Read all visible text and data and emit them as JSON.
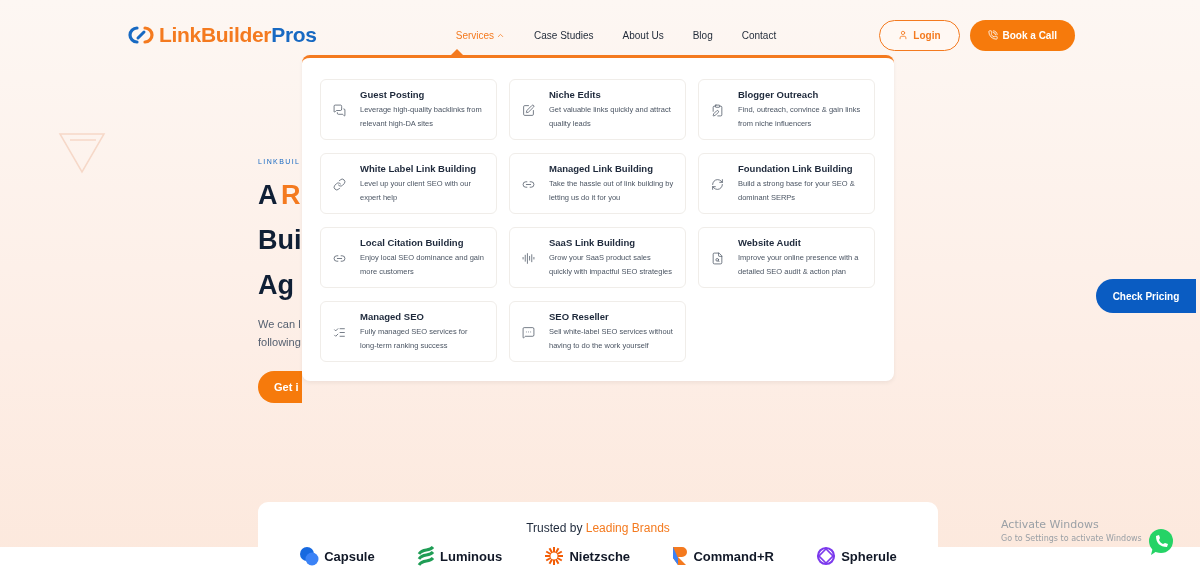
{
  "header": {
    "logo": {
      "part_1": "LinkBuilder",
      "part_2": "Pros"
    },
    "nav": [
      {
        "label": "Services",
        "selected": true,
        "expanded": true
      },
      {
        "label": "Case Studies",
        "selected": false
      },
      {
        "label": "About Us",
        "selected": false
      },
      {
        "label": "Blog",
        "selected": false
      },
      {
        "label": "Contact",
        "selected": false
      }
    ],
    "login": "Login",
    "book_call": "Book a Call"
  },
  "services_menu": [
    {
      "title": "Guest Posting",
      "description": "Leverage high-quality backlinks from relevant high-DA sites"
    },
    {
      "title": "Niche Edits",
      "description": "Get valuable links quickly and attract quality leads"
    },
    {
      "title": "Blogger Outreach",
      "description": "Find, outreach, convince & gain links from niche influencers"
    },
    {
      "title": "White Label Link Building",
      "description": "Level up your client SEO with our expert help"
    },
    {
      "title": "Managed Link Building",
      "description": "Take the hassle out of link building by letting us do it for you"
    },
    {
      "title": "Foundation Link Building",
      "description": "Build a strong base for your SEO & dominant SERPs"
    },
    {
      "title": "Local Citation Building",
      "description": "Enjoy local SEO dominance and gain more customers"
    },
    {
      "title": "SaaS Link Building",
      "description": "Grow your SaaS product sales quickly with impactful SEO strategies"
    },
    {
      "title": "Website Audit",
      "description": "Improve your online presence with a detailed SEO audit & action plan"
    },
    {
      "title": "Managed SEO",
      "description": "Fully managed SEO services for long-term ranking success"
    },
    {
      "title": "SEO Reseller",
      "description": "Sell white-label SEO services without having to do the work yourself"
    }
  ],
  "hero": {
    "tagline": "LINKBUIL",
    "headline": [
      {
        "text": "A",
        "accent": false
      },
      {
        "text": "R",
        "accent": true
      }
    ],
    "headline_lines": [
      "Bui",
      "Ag"
    ],
    "paragraph_lines": [
      "We can l",
      "following"
    ],
    "cta": "Get i"
  },
  "check_pricing": "Check Pricing",
  "trusted": {
    "prefix": "Trusted by",
    "accent": "Leading Brands",
    "brands": [
      "Capsule",
      "Luminous",
      "Nietzsche",
      "Command+R",
      "Spherule"
    ]
  },
  "os_notice": {
    "title": "Activate Windows",
    "subtitle": "Go to Settings to activate Windows"
  }
}
